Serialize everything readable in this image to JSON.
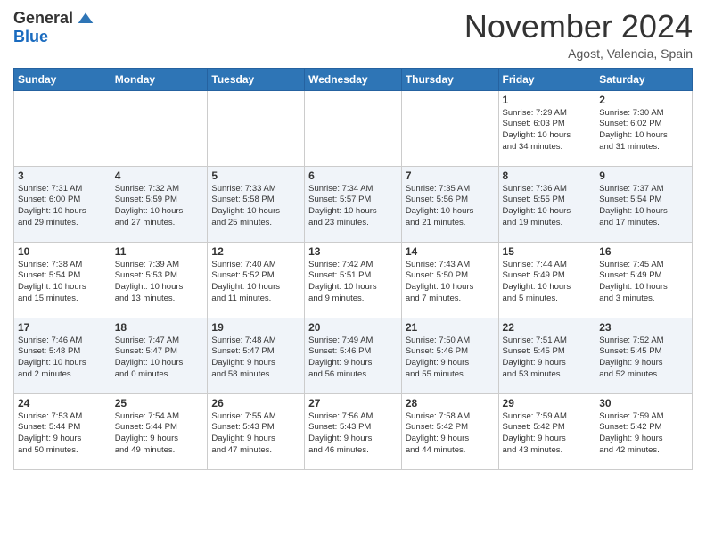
{
  "logo": {
    "general": "General",
    "blue": "Blue"
  },
  "header": {
    "month": "November 2024",
    "location": "Agost, Valencia, Spain"
  },
  "weekdays": [
    "Sunday",
    "Monday",
    "Tuesday",
    "Wednesday",
    "Thursday",
    "Friday",
    "Saturday"
  ],
  "weeks": [
    [
      {
        "day": "",
        "info": ""
      },
      {
        "day": "",
        "info": ""
      },
      {
        "day": "",
        "info": ""
      },
      {
        "day": "",
        "info": ""
      },
      {
        "day": "",
        "info": ""
      },
      {
        "day": "1",
        "info": "Sunrise: 7:29 AM\nSunset: 6:03 PM\nDaylight: 10 hours\nand 34 minutes."
      },
      {
        "day": "2",
        "info": "Sunrise: 7:30 AM\nSunset: 6:02 PM\nDaylight: 10 hours\nand 31 minutes."
      }
    ],
    [
      {
        "day": "3",
        "info": "Sunrise: 7:31 AM\nSunset: 6:00 PM\nDaylight: 10 hours\nand 29 minutes."
      },
      {
        "day": "4",
        "info": "Sunrise: 7:32 AM\nSunset: 5:59 PM\nDaylight: 10 hours\nand 27 minutes."
      },
      {
        "day": "5",
        "info": "Sunrise: 7:33 AM\nSunset: 5:58 PM\nDaylight: 10 hours\nand 25 minutes."
      },
      {
        "day": "6",
        "info": "Sunrise: 7:34 AM\nSunset: 5:57 PM\nDaylight: 10 hours\nand 23 minutes."
      },
      {
        "day": "7",
        "info": "Sunrise: 7:35 AM\nSunset: 5:56 PM\nDaylight: 10 hours\nand 21 minutes."
      },
      {
        "day": "8",
        "info": "Sunrise: 7:36 AM\nSunset: 5:55 PM\nDaylight: 10 hours\nand 19 minutes."
      },
      {
        "day": "9",
        "info": "Sunrise: 7:37 AM\nSunset: 5:54 PM\nDaylight: 10 hours\nand 17 minutes."
      }
    ],
    [
      {
        "day": "10",
        "info": "Sunrise: 7:38 AM\nSunset: 5:54 PM\nDaylight: 10 hours\nand 15 minutes."
      },
      {
        "day": "11",
        "info": "Sunrise: 7:39 AM\nSunset: 5:53 PM\nDaylight: 10 hours\nand 13 minutes."
      },
      {
        "day": "12",
        "info": "Sunrise: 7:40 AM\nSunset: 5:52 PM\nDaylight: 10 hours\nand 11 minutes."
      },
      {
        "day": "13",
        "info": "Sunrise: 7:42 AM\nSunset: 5:51 PM\nDaylight: 10 hours\nand 9 minutes."
      },
      {
        "day": "14",
        "info": "Sunrise: 7:43 AM\nSunset: 5:50 PM\nDaylight: 10 hours\nand 7 minutes."
      },
      {
        "day": "15",
        "info": "Sunrise: 7:44 AM\nSunset: 5:49 PM\nDaylight: 10 hours\nand 5 minutes."
      },
      {
        "day": "16",
        "info": "Sunrise: 7:45 AM\nSunset: 5:49 PM\nDaylight: 10 hours\nand 3 minutes."
      }
    ],
    [
      {
        "day": "17",
        "info": "Sunrise: 7:46 AM\nSunset: 5:48 PM\nDaylight: 10 hours\nand 2 minutes."
      },
      {
        "day": "18",
        "info": "Sunrise: 7:47 AM\nSunset: 5:47 PM\nDaylight: 10 hours\nand 0 minutes."
      },
      {
        "day": "19",
        "info": "Sunrise: 7:48 AM\nSunset: 5:47 PM\nDaylight: 9 hours\nand 58 minutes."
      },
      {
        "day": "20",
        "info": "Sunrise: 7:49 AM\nSunset: 5:46 PM\nDaylight: 9 hours\nand 56 minutes."
      },
      {
        "day": "21",
        "info": "Sunrise: 7:50 AM\nSunset: 5:46 PM\nDaylight: 9 hours\nand 55 minutes."
      },
      {
        "day": "22",
        "info": "Sunrise: 7:51 AM\nSunset: 5:45 PM\nDaylight: 9 hours\nand 53 minutes."
      },
      {
        "day": "23",
        "info": "Sunrise: 7:52 AM\nSunset: 5:45 PM\nDaylight: 9 hours\nand 52 minutes."
      }
    ],
    [
      {
        "day": "24",
        "info": "Sunrise: 7:53 AM\nSunset: 5:44 PM\nDaylight: 9 hours\nand 50 minutes."
      },
      {
        "day": "25",
        "info": "Sunrise: 7:54 AM\nSunset: 5:44 PM\nDaylight: 9 hours\nand 49 minutes."
      },
      {
        "day": "26",
        "info": "Sunrise: 7:55 AM\nSunset: 5:43 PM\nDaylight: 9 hours\nand 47 minutes."
      },
      {
        "day": "27",
        "info": "Sunrise: 7:56 AM\nSunset: 5:43 PM\nDaylight: 9 hours\nand 46 minutes."
      },
      {
        "day": "28",
        "info": "Sunrise: 7:58 AM\nSunset: 5:42 PM\nDaylight: 9 hours\nand 44 minutes."
      },
      {
        "day": "29",
        "info": "Sunrise: 7:59 AM\nSunset: 5:42 PM\nDaylight: 9 hours\nand 43 minutes."
      },
      {
        "day": "30",
        "info": "Sunrise: 7:59 AM\nSunset: 5:42 PM\nDaylight: 9 hours\nand 42 minutes."
      }
    ]
  ]
}
